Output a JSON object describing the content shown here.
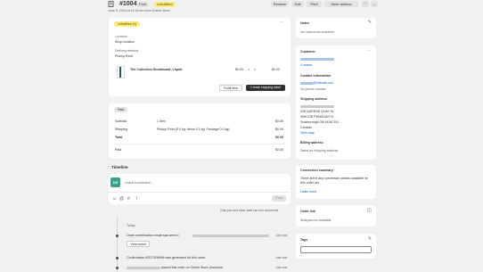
{
  "order": {
    "title": "#1004",
    "paid_badge": "Paid",
    "unfulfilled_badge": "Unfulfilled",
    "subtitle": "June 5, 2024 at 11:18 am from Online Store",
    "restock_label": "Restock",
    "edit_label": "Edit",
    "print_label": "Print",
    "more_actions_label": "More actions"
  },
  "fulfillment": {
    "badge": "Unfulfilled (1)",
    "location_label": "Location",
    "location_value": "Shop location",
    "delivery_label": "Delivery method",
    "delivery_value": "Pickup Point",
    "product_name": "The Collection Snowboard: Liquid",
    "unit_price": "$0.00",
    "times": "×",
    "qty": "1",
    "line_total": "$0.00",
    "fulfill_label": "Fulfill item",
    "create_label_button": "Create shipping label"
  },
  "payment": {
    "badge": "Paid",
    "rows": [
      {
        "label": "Subtotal",
        "detail": "1 item",
        "amount": "$0.00"
      },
      {
        "label": "Shipping",
        "detail": "Pickup Point (0.0 kg: Items 0.0 kg, Package 0.0 kg)",
        "amount": "$0.00"
      },
      {
        "label": "Total",
        "detail": "",
        "amount": "$0.00"
      }
    ],
    "paid_label": "Paid",
    "paid_amount": "$0.00"
  },
  "timeline": {
    "title": "Timeline",
    "avatar": "DS",
    "comment_placeholder": "Leave a comment...",
    "post_label": "Post",
    "visibility_note": "Only you and other staff can see comments",
    "today_label": "Today",
    "events": [
      {
        "text": "Order confirmation email was sent to",
        "time": "Just now",
        "button": "View email"
      },
      {
        "text": "Confirmation #2D7X0NHM was generated for this order.",
        "time": "Just now",
        "button": ""
      },
      {
        "text": "placed this order on Online Store (checkout",
        "time": "Just now",
        "button": ""
      }
    ]
  },
  "notes": {
    "title": "Notes",
    "text": "No notes from customer"
  },
  "customer": {
    "title": "Customer",
    "orders": "4 orders",
    "contact_title": "Contact information",
    "email_suffix": "@hotmail.com",
    "phone": "No phone number",
    "shipping_title": "Shipping address",
    "address_lines": [
      "228 QUEENS QUAY W",
      "SIMCOE PENGUIN FD",
      "Scarborough ON M1M 3X1",
      "Canada"
    ],
    "view_map": "View map",
    "billing_title": "Billing address",
    "billing_text": "Same as shipping address"
  },
  "conversion": {
    "title": "Conversion summary",
    "text": "There aren't any conversion details available for this order yet.",
    "learn_more": "Learn more"
  },
  "risk": {
    "title": "Order risk",
    "text": "Analysis not available"
  },
  "tags": {
    "title": "Tags"
  },
  "colors": {
    "accent": "#005bd3",
    "paid_bg": "#e3e3e3",
    "unfulfilled_bg": "#ffeb78",
    "dark_button": "#303030"
  },
  "icons": [
    "receipt-icon",
    "chevron-up-icon",
    "chevron-down-icon",
    "edit-icon",
    "ellipsis-icon",
    "emoji-icon",
    "at-icon",
    "hash-icon",
    "attach-icon"
  ]
}
